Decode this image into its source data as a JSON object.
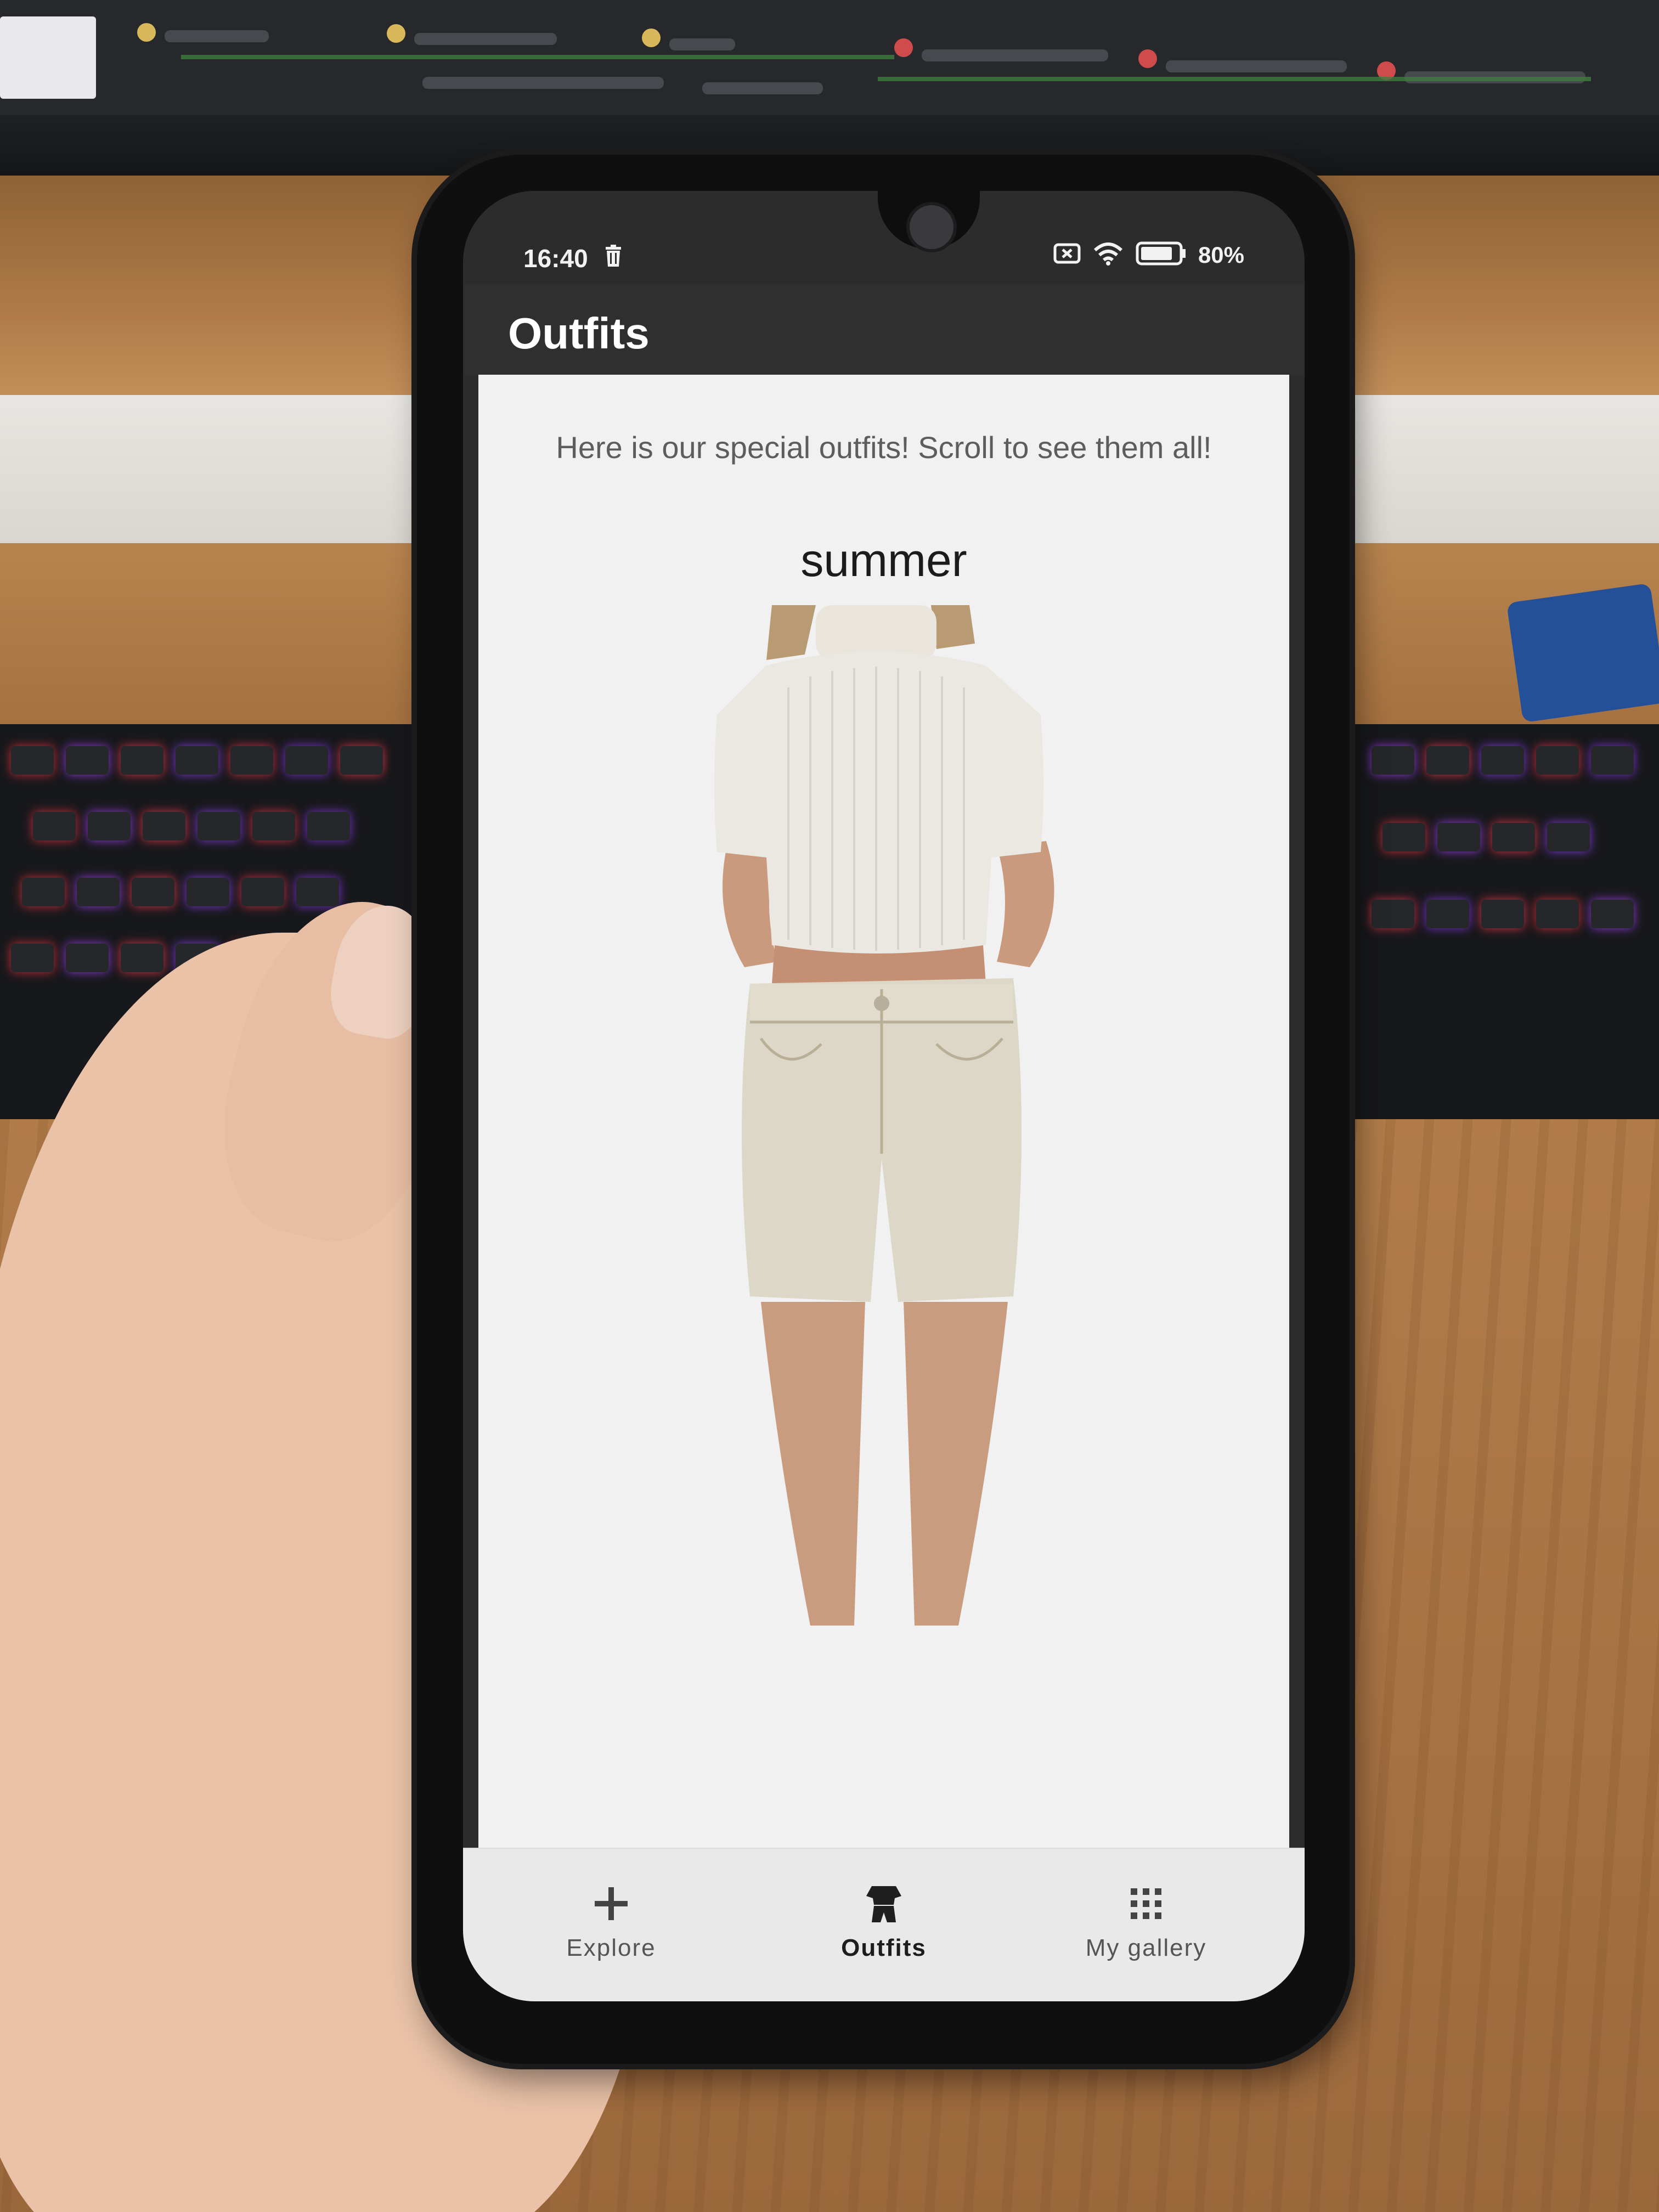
{
  "status_bar": {
    "time": "16:40",
    "battery_percent": "80%"
  },
  "app_bar": {
    "title": "Outfits"
  },
  "content": {
    "intro_text": "Here is our special outfits! Scroll to see them all!",
    "outfits": [
      {
        "title": "summer"
      }
    ]
  },
  "bottom_nav": {
    "items": [
      {
        "label": "Explore",
        "icon": "plus-icon",
        "active": false
      },
      {
        "label": "Outfits",
        "icon": "outfit-icon",
        "active": true
      },
      {
        "label": "My gallery",
        "icon": "grid-icon",
        "active": false
      }
    ]
  },
  "colors": {
    "app_bar": "#2f2f30",
    "content_background": "#f1f1f1",
    "nav_background": "#e9e9e9"
  }
}
